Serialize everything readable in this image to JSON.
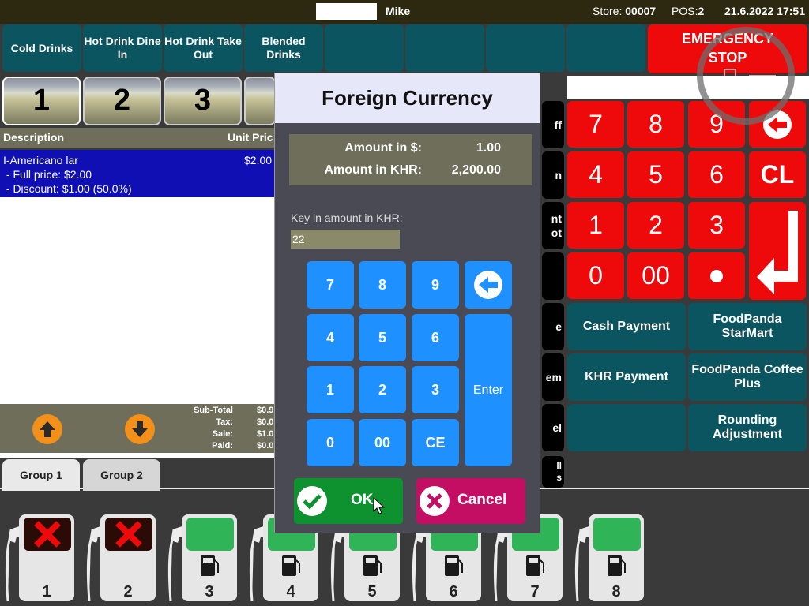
{
  "topbar": {
    "user": "Mike",
    "store_label": "Store:",
    "store_value": "00007",
    "pos_label": "POS:",
    "pos_value": "2",
    "datetime": "21.6.2022 17:51"
  },
  "categories": [
    "Cold Drinks",
    "Hot Drink Dine In",
    "Hot Drink Take Out",
    "Blended Drinks"
  ],
  "emergency": {
    "line1": "EMERGENCY",
    "line2": "STOP"
  },
  "tabs": [
    "1",
    "2",
    "3"
  ],
  "list": {
    "col_description": "Description",
    "col_unit_price": "Unit Pric",
    "item_name": "I-Americano lar",
    "item_price": "$2.00",
    "item_full_price": " - Full price: $2.00",
    "item_discount": " - Discount: $1.00 (50.0%)"
  },
  "totals": {
    "subtotal_label": "Sub-Total",
    "subtotal_value": "$0.9",
    "tax_label": "Tax:",
    "tax_value": "$0.0",
    "sale_label": "Sale:",
    "sale_value": "$1.0",
    "paid_label": "Paid:",
    "paid_value": "$0.0"
  },
  "groups": [
    "Group 1",
    "Group 2"
  ],
  "pumps": [
    {
      "number": "1",
      "status": "error"
    },
    {
      "number": "2",
      "status": "error"
    },
    {
      "number": "3",
      "status": "ready"
    },
    {
      "number": "4",
      "status": "ready"
    },
    {
      "number": "5",
      "status": "ready"
    },
    {
      "number": "6",
      "status": "ready"
    },
    {
      "number": "7",
      "status": "ready"
    },
    {
      "number": "8",
      "status": "ready"
    }
  ],
  "keypad_right": {
    "k7": "7",
    "k8": "8",
    "k9": "9",
    "k4": "4",
    "k5": "5",
    "k6": "6",
    "kcl": "CL",
    "k1": "1",
    "k2": "2",
    "k3": "3",
    "k0": "0",
    "k00": "00"
  },
  "side_buttons": [
    "ff",
    "n",
    "nt\not",
    "",
    "e",
    "em",
    "el",
    "ll\ns"
  ],
  "payments": {
    "cash": "Cash Payment",
    "foodpanda_starmart": "FoodPanda StarMart",
    "khr": "KHR Payment",
    "foodpanda_coffee": "FoodPanda Coffee Plus",
    "rounding": "Rounding Adjustment"
  },
  "dialog": {
    "title": "Foreign Currency",
    "amount_usd_label": "Amount in $:",
    "amount_usd_value": "1.00",
    "amount_khr_label": "Amount in KHR:",
    "amount_khr_value": "2,200.00",
    "key_in_label": "Key in amount in KHR:",
    "input_value": "22",
    "keys": {
      "k7": "7",
      "k8": "8",
      "k9": "9",
      "k4": "4",
      "k5": "5",
      "k6": "6",
      "k1": "1",
      "k2": "2",
      "k3": "3",
      "k0": "0",
      "k00": "00",
      "kce": "CE",
      "enter": "Enter"
    },
    "ok_label": "OK",
    "cancel_label": "Cancel"
  },
  "colors": {
    "teal": "#0b5560",
    "red": "#ee0a0a",
    "blue_key": "#1e90ff",
    "ok_green": "#0e9230",
    "cancel_magenta": "#c40e63"
  }
}
